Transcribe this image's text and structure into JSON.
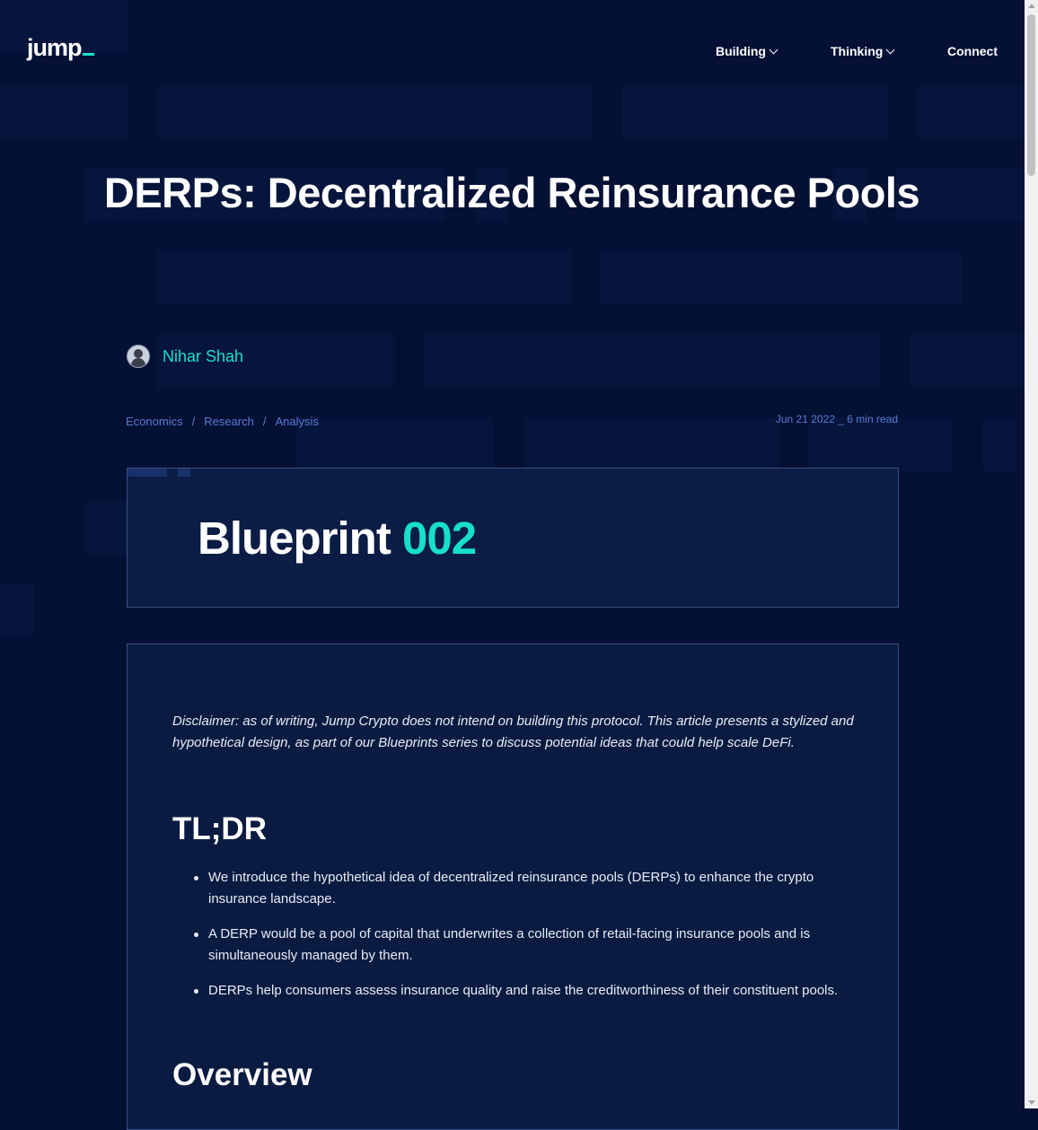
{
  "header": {
    "logo_text": "jump",
    "nav": [
      {
        "label": "Building",
        "has_dropdown": true
      },
      {
        "label": "Thinking",
        "has_dropdown": true
      },
      {
        "label": "Connect",
        "has_dropdown": false
      }
    ]
  },
  "article": {
    "title": "DERPs: Decentralized Reinsurance Pools",
    "author": "Nihar Shah",
    "breadcrumbs": [
      "Economics",
      "Research",
      "Analysis"
    ],
    "date": "Jun 21 2022",
    "separator": "_",
    "read_time": "6 min read",
    "banner": {
      "word": "Blueprint",
      "number": "002"
    },
    "disclaimer": "Disclaimer: as of writing, Jump Crypto does not intend on building this protocol. This article presents a stylized and hypothetical design, as part of our Blueprints series to discuss potential ideas that could help scale DeFi.",
    "tldr_heading": "TL;DR",
    "tldr_items": [
      "We introduce the hypothetical idea of decentralized reinsurance pools (DERPs) to enhance the crypto insurance landscape.",
      "A DERP would be a pool of capital that underwrites a collection of retail-facing insurance pools and is simultaneously managed by them.",
      "DERPs help consumers assess insurance quality and raise the creditworthiness of their constituent pools."
    ],
    "overview_heading": "Overview"
  },
  "colors": {
    "background": "#041034",
    "accent": "#16e0c6",
    "link": "#5b7bd2",
    "panel": "#0a1b41"
  }
}
